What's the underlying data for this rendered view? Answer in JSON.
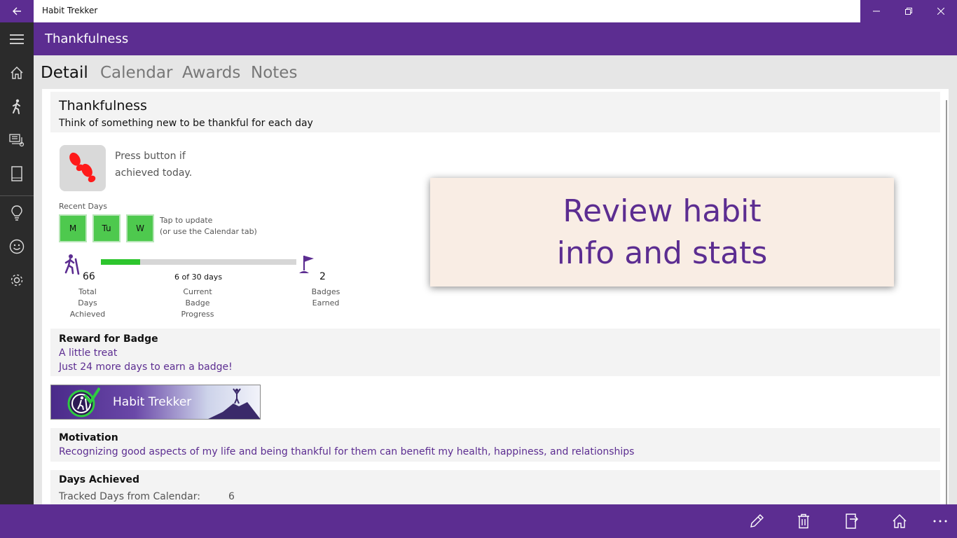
{
  "window": {
    "title": "Habit Trekker"
  },
  "header": {
    "title": "Thankfulness"
  },
  "tabs": [
    {
      "label": "Detail",
      "active": true
    },
    {
      "label": "Calendar",
      "active": false
    },
    {
      "label": "Awards",
      "active": false
    },
    {
      "label": "Notes",
      "active": false
    }
  ],
  "habit": {
    "name": "Thankfulness",
    "description": "Think of something new to be thankful for each day",
    "press_text": "Press button if achieved today."
  },
  "recent_days": {
    "label": "Recent Days",
    "days": [
      "M",
      "Tu",
      "W"
    ],
    "tap_line1": "Tap to update",
    "tap_line2": "(or use the Calendar tab)"
  },
  "stats": {
    "total_days": "66",
    "total_label": [
      "Total",
      "Days",
      "Achieved"
    ],
    "progress_value": 6,
    "progress_max": 30,
    "progress_text": "6 of 30 days",
    "progress_label": [
      "Current",
      "Badge",
      "Progress"
    ],
    "badges": "2",
    "badges_label": [
      "Badges",
      "Earned"
    ]
  },
  "reward": {
    "heading": "Reward for Badge",
    "reward_text": "A little treat",
    "remaining_text": "Just 24 more days to earn a badge!"
  },
  "banner": {
    "text": "Habit Trekker"
  },
  "motivation": {
    "heading": "Motivation",
    "text": "Recognizing good aspects of my life and being thankful for them can benefit my health, happiness, and relationships"
  },
  "days_achieved": {
    "heading": "Days Achieved",
    "tracked_label": "Tracked Days from Calendar:",
    "tracked_value": "6"
  },
  "overlay": {
    "line1": "Review habit",
    "line2": "info and stats"
  },
  "colors": {
    "accent": "#5c2d91",
    "rail": "#2b2b2b",
    "day_green": "#4ec94e",
    "progress_green": "#2dc52d",
    "overlay_bg": "#f9ede4"
  },
  "icons": {
    "rail": [
      "hamburger-menu-icon",
      "home-icon",
      "hiker-icon",
      "habit-list-icon",
      "tablet-icon",
      "lightbulb-icon",
      "smiley-icon",
      "settings-icon"
    ],
    "appbar": [
      "edit-icon",
      "delete-icon",
      "export-icon",
      "home-icon",
      "more-icon"
    ]
  }
}
